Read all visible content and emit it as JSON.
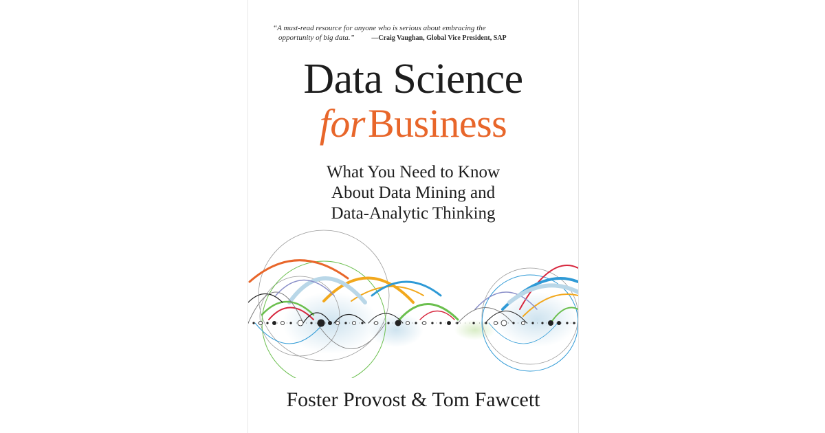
{
  "cover": {
    "blurb": {
      "line1": "“A must-read resource for anyone who is serious about embracing the",
      "line2": "opportunity of big data.”",
      "attribution": "—Craig Vaughan, Global Vice President, SAP"
    },
    "title_line1": "Data Science",
    "title_for": "for",
    "title_business": "Business",
    "subtitle": [
      "What You Need to Know",
      "About Data Mining and",
      "Data-Analytic Thinking"
    ],
    "authors": "Foster Provost & Tom Fawcett"
  },
  "colors": {
    "title": "#1d1d1d",
    "accent_orange": "#e8662a",
    "arc_colors": [
      "#e8662a",
      "#f2a81d",
      "#2f9ad6",
      "#6bbf4e",
      "#d7263d",
      "#8a8fc9",
      "#b9d7e8",
      "#7a7a7a",
      "#222222"
    ]
  }
}
